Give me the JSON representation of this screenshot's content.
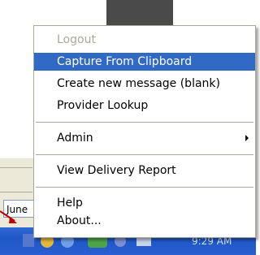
{
  "menu": {
    "items": [
      {
        "label": "Logout",
        "enabled": false
      },
      {
        "label": "Capture From Clipboard",
        "enabled": true,
        "selected": true
      },
      {
        "label": "Create new message (blank)",
        "enabled": true
      },
      {
        "label": "Provider Lookup",
        "enabled": true
      },
      {
        "label": "Admin",
        "enabled": true,
        "submenu": true
      },
      {
        "label": "View Delivery Report",
        "enabled": true
      },
      {
        "label": "Help",
        "enabled": true
      },
      {
        "label": "About...",
        "enabled": true
      }
    ]
  },
  "background": {
    "date_field_value": "June",
    "clock": "9:29 AM"
  },
  "colors": {
    "highlight": "#316ac5",
    "disabled_text": "#aca899",
    "taskbar": "#2a5fd1",
    "annotation_arrow": "#c00000"
  }
}
